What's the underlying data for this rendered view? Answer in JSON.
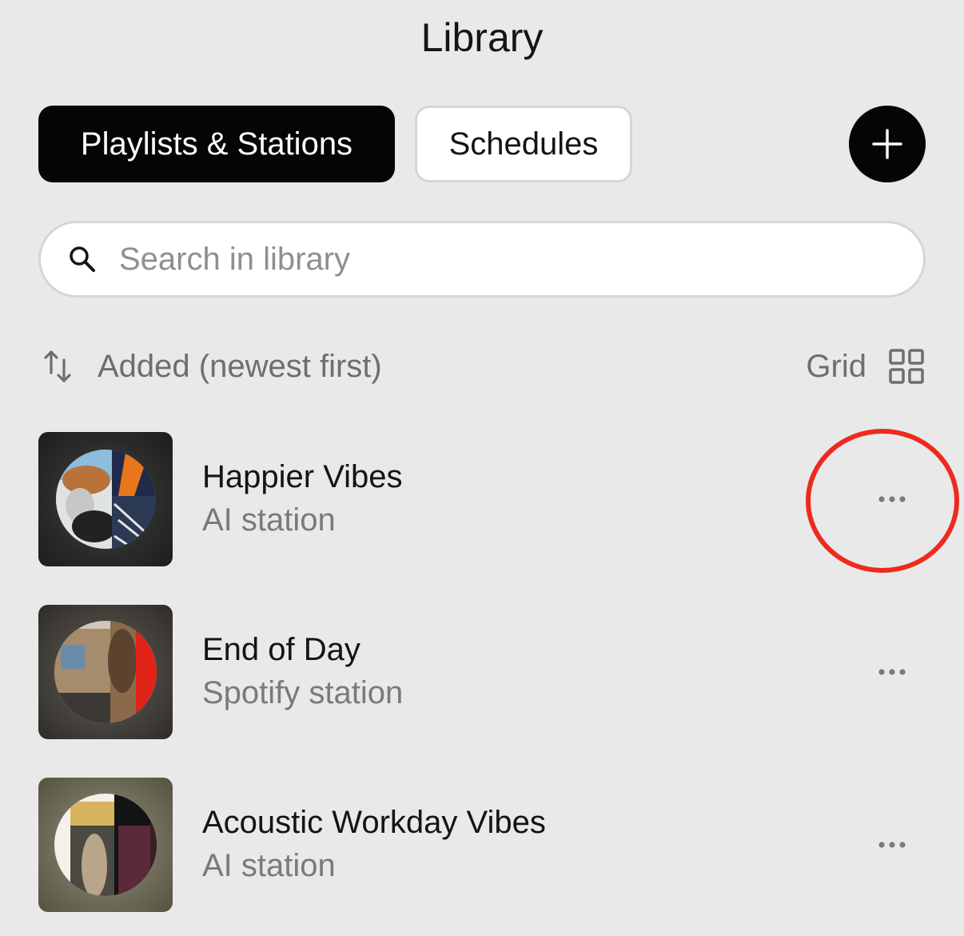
{
  "header": {
    "title": "Library"
  },
  "tabs": [
    {
      "label": "Playlists & Stations",
      "active": true
    },
    {
      "label": "Schedules",
      "active": false
    }
  ],
  "add_button": {
    "icon": "plus-icon"
  },
  "search": {
    "placeholder": "Search in library",
    "value": "",
    "icon": "search-icon"
  },
  "sort": {
    "label": "Added (newest first)",
    "icon": "sort-arrows-icon"
  },
  "view": {
    "label": "Grid",
    "icon": "grid-icon"
  },
  "items": [
    {
      "title": "Happier Vibes",
      "subtitle": "AI station",
      "more_icon": "ellipsis-icon",
      "highlighted": true
    },
    {
      "title": "End of Day",
      "subtitle": "Spotify station",
      "more_icon": "ellipsis-icon"
    },
    {
      "title": "Acoustic Workday Vibes",
      "subtitle": "AI station",
      "more_icon": "ellipsis-icon"
    }
  ],
  "colors": {
    "background": "#e9e9e9",
    "accent": "#050505",
    "highlight": "#ee2a1f",
    "muted_text": "#7a7a7a"
  }
}
